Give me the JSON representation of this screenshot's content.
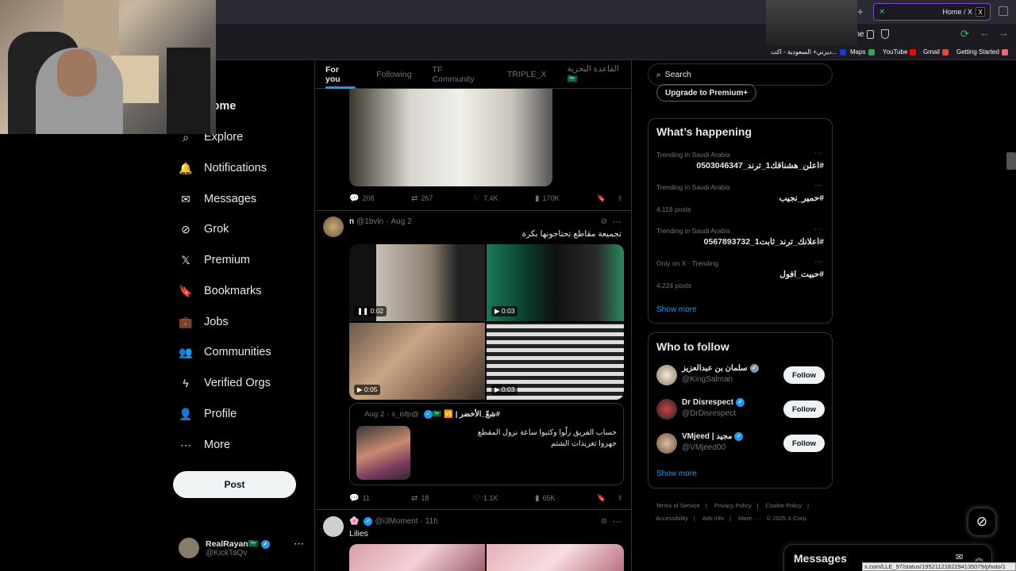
{
  "browser": {
    "tab_title": "Home / X",
    "tab_logo": "X",
    "url": "x.com/home",
    "bookmarks": [
      "Getting Started",
      "Gmail",
      "YouTube",
      "Maps",
      "ديزني+ السعودية - اكت..."
    ]
  },
  "sidebar": {
    "items": [
      {
        "label": "Home",
        "icon": "home-icon",
        "glyph": "⌂"
      },
      {
        "label": "Explore",
        "icon": "search-icon",
        "glyph": "⌕"
      },
      {
        "label": "Notifications",
        "icon": "bell-icon",
        "glyph": "🔔"
      },
      {
        "label": "Messages",
        "icon": "envelope-icon",
        "glyph": "✉"
      },
      {
        "label": "Grok",
        "icon": "grok-icon",
        "glyph": "⊘"
      },
      {
        "label": "Premium",
        "icon": "x-logo-icon",
        "glyph": "𝕏"
      },
      {
        "label": "Bookmarks",
        "icon": "bookmark-icon",
        "glyph": "🔖"
      },
      {
        "label": "Jobs",
        "icon": "briefcase-icon",
        "glyph": "💼"
      },
      {
        "label": "Communities",
        "icon": "people-icon",
        "glyph": "👥"
      },
      {
        "label": "Verified Orgs",
        "icon": "lightning-icon",
        "glyph": "ϟ"
      },
      {
        "label": "Profile",
        "icon": "person-icon",
        "glyph": "👤"
      },
      {
        "label": "More",
        "icon": "more-circle-icon",
        "glyph": "⋯"
      }
    ],
    "post_label": "Post",
    "user": {
      "name": "RealRayan🇸🇦",
      "handle": "@KickTaQv"
    }
  },
  "feed": {
    "tabs": [
      "For you",
      "Following",
      "TF Community",
      "TRIPLE_X",
      "القاعدة البحرية 🇸🇦"
    ],
    "post1_actions": {
      "replies": "208",
      "reposts": "267",
      "likes": "7.4K",
      "views": "170K"
    },
    "post2": {
      "name": "n",
      "handle": "@1bvln",
      "date": "Aug 2",
      "text": "تجميعة مقاطع تحتاجونها بكرة",
      "videos": [
        "0:02",
        "0:03",
        "0:05",
        "0:03"
      ],
      "quote": {
        "name": "#شعّ_الأخضر | 🇸🇦 🆚",
        "handle": "@s_isfp",
        "date": "Aug 2",
        "line1": "حساب الفريق زلّوا وكتبوا ساعة نزول المقطع",
        "line2": "جهزوا تغريدات الشتم"
      },
      "actions": {
        "replies": "11",
        "reposts": "18",
        "likes": "1.1K",
        "views": "65K"
      }
    },
    "post3": {
      "name": "🌸",
      "handle": "@i3Moment",
      "date": "11h",
      "text": "Lilies"
    }
  },
  "right": {
    "search_placeholder": "Search",
    "premium_label": "Upgrade to Premium+",
    "happening_title": "What’s happening",
    "trends": [
      {
        "meta": "Trending in Saudi Arabia",
        "name": "#اعلن_هشناقك1_ترند_0503046347",
        "posts": ""
      },
      {
        "meta": "Trending in Saudi Arabia",
        "name": "#حمير_نجيب",
        "posts": "4,118 posts"
      },
      {
        "meta": "Trending in Saudi Arabia",
        "name": "#اعلانك_ترند_ثابت1_0567893732",
        "posts": ""
      },
      {
        "meta": "Only on X · Trending",
        "name": "#حبيت_افول",
        "posts": "4,224 posts"
      }
    ],
    "show_more": "Show more",
    "wtf_title": "Who to follow",
    "follow": [
      {
        "name": "سلمان بن عبدالعزيز",
        "handle": "@KingSalman"
      },
      {
        "name": "Dr Disrespect",
        "handle": "@DrDisrespect"
      },
      {
        "name": "VMjeed | مجيد",
        "handle": "@VMjeed00"
      }
    ],
    "follow_label": "Follow",
    "footer": [
      "Terms of Service",
      "Privacy Policy",
      "Cookie Policy",
      "Accessibility",
      "Ads info",
      "More ···",
      "© 2025 X Corp."
    ]
  },
  "messages_label": "Messages",
  "status_url": "x.com/LLE_97/status/1952112182294135079/photo/1",
  "colors": {
    "accent": "#1d9bf0",
    "background": "#000000",
    "browser_accent": "#22c55e"
  }
}
